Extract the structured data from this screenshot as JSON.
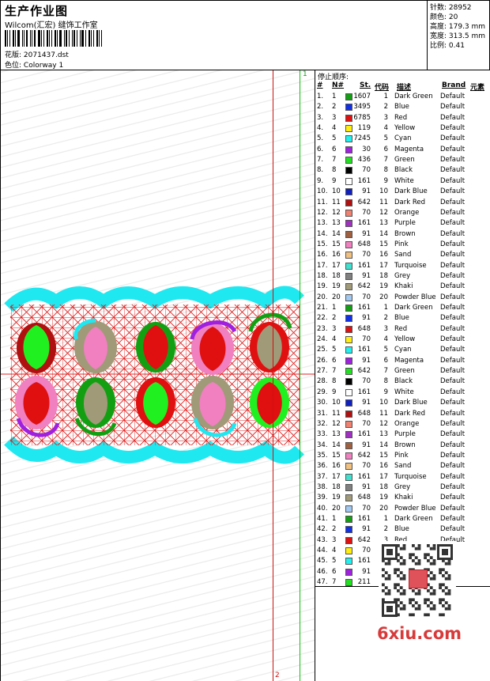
{
  "header": {
    "title": "生产作业图",
    "subtitle": "Wilcom(汇宏) 缝饰工作室",
    "design_file_label": "花版:",
    "design_file": "2071437.dst",
    "colorway_label": "色位:",
    "colorway": "Colorway 1"
  },
  "stats": {
    "stitches": "针数: 28952",
    "colors": "颜色: 20",
    "height": "高度: 179.3 mm",
    "width": "宽度: 313.5 mm",
    "scale": "比例: 0.41"
  },
  "canvas": {
    "marker_1": "1",
    "marker_2": "2"
  },
  "stops": {
    "title": "停止顺序:",
    "headers": {
      "idx": "#",
      "n": "N#",
      "st": "St.",
      "code": "代码",
      "desc": "描述",
      "brand": "Brand",
      "element": "元素"
    },
    "rows": [
      {
        "i": "1.",
        "n": "1",
        "color": "#12a012",
        "st": "1607",
        "code": "1",
        "name": "Dark Green",
        "brand": "Default"
      },
      {
        "i": "2.",
        "n": "2",
        "color": "#1030e8",
        "st": "3495",
        "code": "2",
        "name": "Blue",
        "brand": "Default"
      },
      {
        "i": "3.",
        "n": "3",
        "color": "#e01010",
        "st": "6785",
        "code": "3",
        "name": "Red",
        "brand": "Default"
      },
      {
        "i": "4.",
        "n": "4",
        "color": "#ffee10",
        "st": "119",
        "code": "4",
        "name": "Yellow",
        "brand": "Default"
      },
      {
        "i": "5.",
        "n": "5",
        "color": "#20f0f0",
        "st": "7245",
        "code": "5",
        "name": "Cyan",
        "brand": "Default"
      },
      {
        "i": "6.",
        "n": "6",
        "color": "#a020e0",
        "st": "30",
        "code": "6",
        "name": "Magenta",
        "brand": "Default"
      },
      {
        "i": "7.",
        "n": "7",
        "color": "#20e020",
        "st": "436",
        "code": "7",
        "name": "Green",
        "brand": "Default"
      },
      {
        "i": "8.",
        "n": "8",
        "color": "#000000",
        "st": "70",
        "code": "8",
        "name": "Black",
        "brand": "Default"
      },
      {
        "i": "9.",
        "n": "9",
        "color": "#ffffff",
        "st": "161",
        "code": "9",
        "name": "White",
        "brand": "Default"
      },
      {
        "i": "10.",
        "n": "10",
        "color": "#1020c0",
        "st": "91",
        "code": "10",
        "name": "Dark Blue",
        "brand": "Default"
      },
      {
        "i": "11.",
        "n": "11",
        "color": "#b01010",
        "st": "642",
        "code": "11",
        "name": "Dark Red",
        "brand": "Default"
      },
      {
        "i": "12.",
        "n": "12",
        "color": "#f08070",
        "st": "70",
        "code": "12",
        "name": "Orange",
        "brand": "Default"
      },
      {
        "i": "13.",
        "n": "13",
        "color": "#a030c0",
        "st": "161",
        "code": "13",
        "name": "Purple",
        "brand": "Default"
      },
      {
        "i": "14.",
        "n": "14",
        "color": "#a06040",
        "st": "91",
        "code": "14",
        "name": "Brown",
        "brand": "Default"
      },
      {
        "i": "15.",
        "n": "15",
        "color": "#f080c0",
        "st": "648",
        "code": "15",
        "name": "Pink",
        "brand": "Default"
      },
      {
        "i": "16.",
        "n": "16",
        "color": "#f0c080",
        "st": "70",
        "code": "16",
        "name": "Sand",
        "brand": "Default"
      },
      {
        "i": "17.",
        "n": "17",
        "color": "#40e0d0",
        "st": "161",
        "code": "17",
        "name": "Turquoise",
        "brand": "Default"
      },
      {
        "i": "18.",
        "n": "18",
        "color": "#808080",
        "st": "91",
        "code": "18",
        "name": "Grey",
        "brand": "Default"
      },
      {
        "i": "19.",
        "n": "19",
        "color": "#a09a78",
        "st": "642",
        "code": "19",
        "name": "Khaki",
        "brand": "Default"
      },
      {
        "i": "20.",
        "n": "20",
        "color": "#a0c8f0",
        "st": "70",
        "code": "20",
        "name": "Powder Blue",
        "brand": "Default"
      },
      {
        "i": "21.",
        "n": "1",
        "color": "#12a012",
        "st": "161",
        "code": "1",
        "name": "Dark Green",
        "brand": "Default"
      },
      {
        "i": "22.",
        "n": "2",
        "color": "#1030e8",
        "st": "91",
        "code": "2",
        "name": "Blue",
        "brand": "Default"
      },
      {
        "i": "23.",
        "n": "3",
        "color": "#e01010",
        "st": "648",
        "code": "3",
        "name": "Red",
        "brand": "Default"
      },
      {
        "i": "24.",
        "n": "4",
        "color": "#ffee10",
        "st": "70",
        "code": "4",
        "name": "Yellow",
        "brand": "Default"
      },
      {
        "i": "25.",
        "n": "5",
        "color": "#20f0f0",
        "st": "161",
        "code": "5",
        "name": "Cyan",
        "brand": "Default"
      },
      {
        "i": "26.",
        "n": "6",
        "color": "#a020e0",
        "st": "91",
        "code": "6",
        "name": "Magenta",
        "brand": "Default"
      },
      {
        "i": "27.",
        "n": "7",
        "color": "#20e020",
        "st": "642",
        "code": "7",
        "name": "Green",
        "brand": "Default"
      },
      {
        "i": "28.",
        "n": "8",
        "color": "#000000",
        "st": "70",
        "code": "8",
        "name": "Black",
        "brand": "Default"
      },
      {
        "i": "29.",
        "n": "9",
        "color": "#ffffff",
        "st": "161",
        "code": "9",
        "name": "White",
        "brand": "Default"
      },
      {
        "i": "30.",
        "n": "10",
        "color": "#1020c0",
        "st": "91",
        "code": "10",
        "name": "Dark Blue",
        "brand": "Default"
      },
      {
        "i": "31.",
        "n": "11",
        "color": "#b01010",
        "st": "648",
        "code": "11",
        "name": "Dark Red",
        "brand": "Default"
      },
      {
        "i": "32.",
        "n": "12",
        "color": "#f08070",
        "st": "70",
        "code": "12",
        "name": "Orange",
        "brand": "Default"
      },
      {
        "i": "33.",
        "n": "13",
        "color": "#a030c0",
        "st": "161",
        "code": "13",
        "name": "Purple",
        "brand": "Default"
      },
      {
        "i": "34.",
        "n": "14",
        "color": "#a06040",
        "st": "91",
        "code": "14",
        "name": "Brown",
        "brand": "Default"
      },
      {
        "i": "35.",
        "n": "15",
        "color": "#f080c0",
        "st": "642",
        "code": "15",
        "name": "Pink",
        "brand": "Default"
      },
      {
        "i": "36.",
        "n": "16",
        "color": "#f0c080",
        "st": "70",
        "code": "16",
        "name": "Sand",
        "brand": "Default"
      },
      {
        "i": "37.",
        "n": "17",
        "color": "#40e0d0",
        "st": "161",
        "code": "17",
        "name": "Turquoise",
        "brand": "Default"
      },
      {
        "i": "38.",
        "n": "18",
        "color": "#808080",
        "st": "91",
        "code": "18",
        "name": "Grey",
        "brand": "Default"
      },
      {
        "i": "39.",
        "n": "19",
        "color": "#a09a78",
        "st": "648",
        "code": "19",
        "name": "Khaki",
        "brand": "Default"
      },
      {
        "i": "40.",
        "n": "20",
        "color": "#a0c8f0",
        "st": "70",
        "code": "20",
        "name": "Powder Blue",
        "brand": "Default"
      },
      {
        "i": "41.",
        "n": "1",
        "color": "#12a012",
        "st": "161",
        "code": "1",
        "name": "Dark Green",
        "brand": "Default"
      },
      {
        "i": "42.",
        "n": "2",
        "color": "#1030e8",
        "st": "91",
        "code": "2",
        "name": "Blue",
        "brand": "Default"
      },
      {
        "i": "43.",
        "n": "3",
        "color": "#e01010",
        "st": "642",
        "code": "3",
        "name": "Red",
        "brand": "Default"
      },
      {
        "i": "44.",
        "n": "4",
        "color": "#ffee10",
        "st": "70",
        "code": "",
        "name": "",
        "brand": ""
      },
      {
        "i": "45.",
        "n": "5",
        "color": "#20f0f0",
        "st": "161",
        "code": "",
        "name": "",
        "brand": ""
      },
      {
        "i": "46.",
        "n": "6",
        "color": "#a020e0",
        "st": "91",
        "code": "",
        "name": "",
        "brand": ""
      },
      {
        "i": "47.",
        "n": "7",
        "color": "#20e020",
        "st": "211",
        "code": "",
        "name": "",
        "brand": ""
      }
    ]
  },
  "watermark": "6xiu.com"
}
